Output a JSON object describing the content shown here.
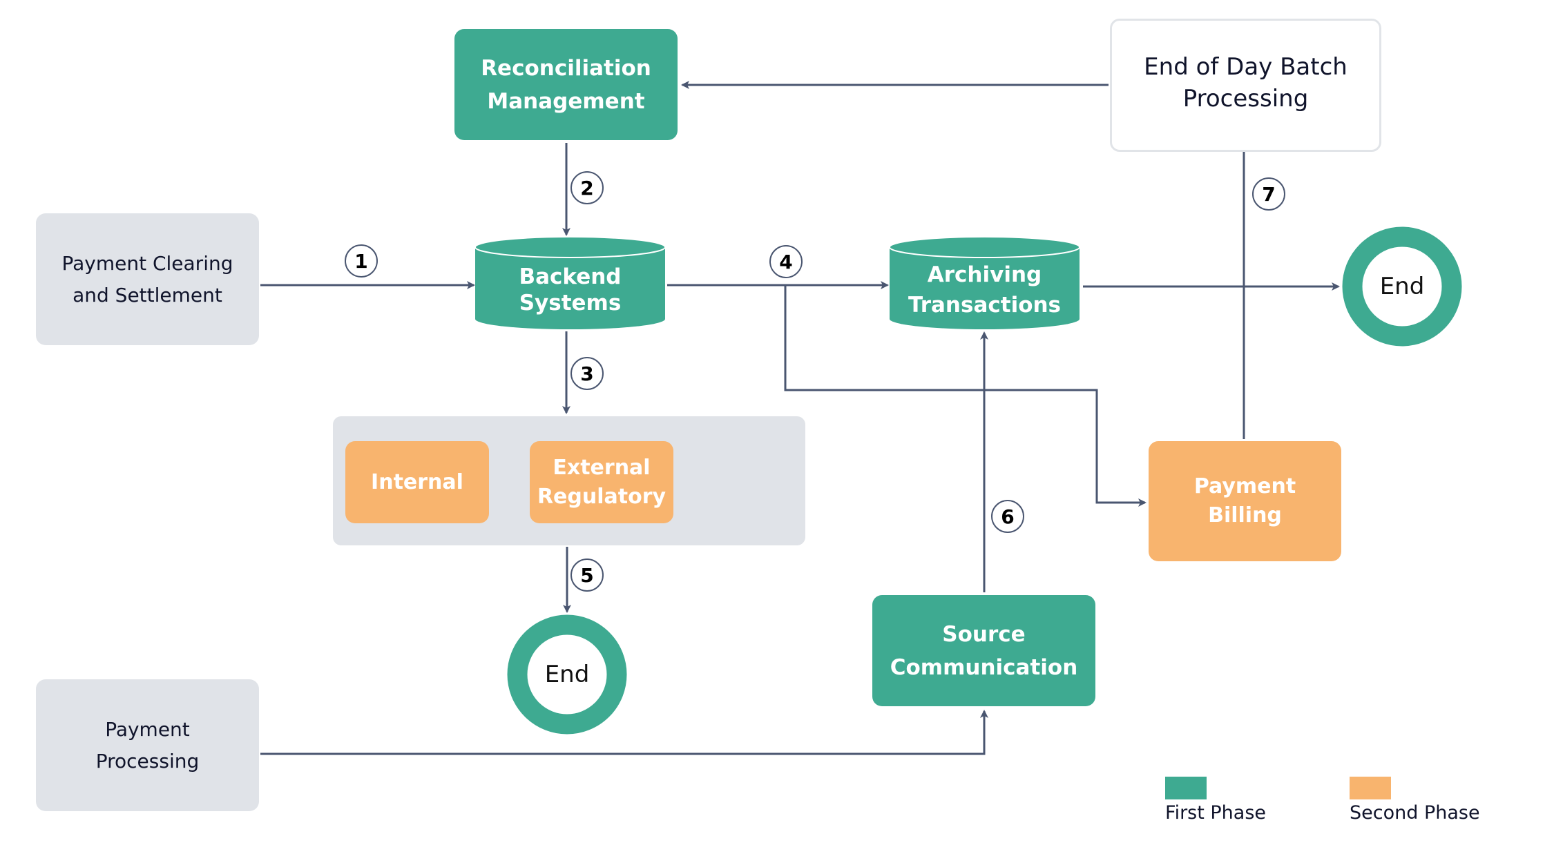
{
  "colors": {
    "first_phase": "#3eaa91",
    "second_phase": "#f8b46e",
    "source_node": "#e0e3e8",
    "connector": "#4a5670"
  },
  "nodes": {
    "reconciliation": "Reconciliation\nManagement",
    "end_of_day": "End of Day Batch\nProcessing",
    "payment_clearing": "Payment Clearing\nand Settlement",
    "backend": "Backend\nSystems",
    "archiving": "Archiving\nTransactions",
    "end_right": "End",
    "internal": "Internal",
    "external": "External\nRegulatory",
    "payment_billing": "Payment\nBilling",
    "end_bottom": "End",
    "source_comm": "Source\nCommunication",
    "payment_processing": "Payment\nProcessing"
  },
  "steps": [
    "1",
    "2",
    "3",
    "4",
    "5",
    "6",
    "7"
  ],
  "legend": {
    "first": "First Phase",
    "second": "Second Phase"
  }
}
